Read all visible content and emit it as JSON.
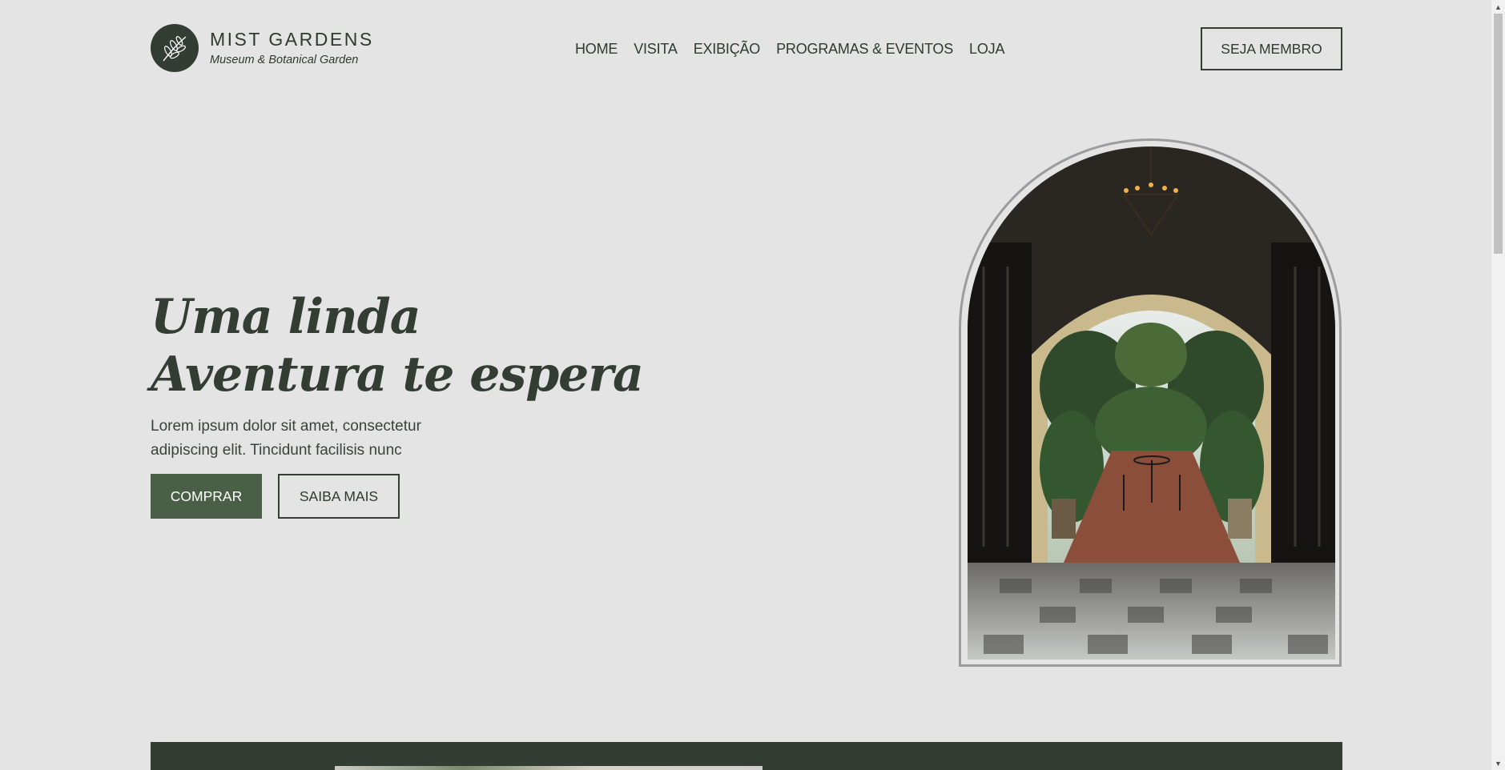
{
  "brand": {
    "name": "MIST GARDENS",
    "subtitle": "Museum & Botanical Garden",
    "logo_icon": "leaf-branch-icon"
  },
  "nav": {
    "items": [
      "HOME",
      "VISITA",
      "EXIBIÇÃO",
      "PROGRAMAS & EVENTOS",
      "LOJA"
    ]
  },
  "header": {
    "member_button": "SEJA MEMBRO"
  },
  "hero": {
    "title_line1": "Uma linda",
    "title_line2": "Aventura te espera",
    "description": "Lorem ipsum dolor sit amet, consectetur adipiscing elit. Tincidunt facilisis nunc",
    "buy_button": "COMPRAR",
    "more_button": "SAIBA MAIS",
    "image_subject": "arched doorway leading to tropical courtyard garden"
  },
  "colors": {
    "background": "#e4e4e4",
    "primary_dark": "#333d34",
    "accent_green": "#4a6046",
    "arch_border": "#9c9c9c"
  }
}
